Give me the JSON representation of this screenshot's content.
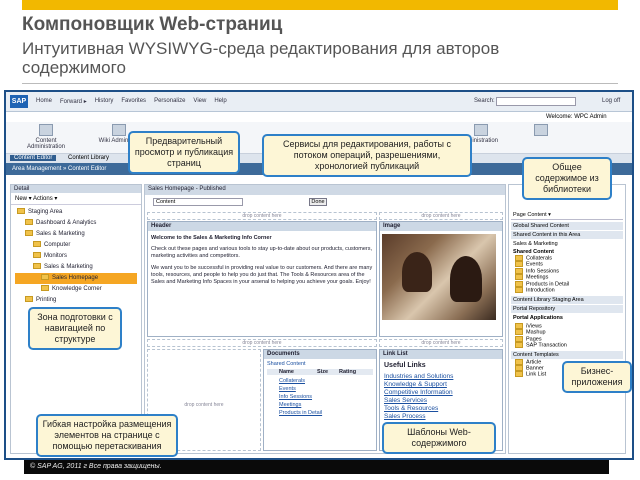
{
  "title": "Компоновщик Web-страниц",
  "subtitle": "Интуитивная WYSIWYG-среда редактирования для авторов содержимого",
  "sap": {
    "logo": "SAP",
    "menu": [
      "Home",
      "Forward ▸",
      "History",
      "Favorites",
      "Personalize",
      "View",
      "Help"
    ],
    "search_label": "Search:",
    "welcome": "Welcome: WPC Admin",
    "logoff": "Log off"
  },
  "toolbar": [
    "Content Administration",
    "Wiki Administ...",
    "",
    "",
    "",
    "",
    "",
    "",
    "",
    "",
    "dministration"
  ],
  "tabs": [
    "Content Editor",
    "Content Library"
  ],
  "crumb": "Area Management  »  Content Editor",
  "tree": {
    "head": "Detail",
    "actions": "New ▾   Actions ▾",
    "items": [
      "Staging Area",
      "Dashboard & Analytics",
      "Sales & Marketing",
      "Computer",
      "Monitors",
      "Sales & Marketing",
      "Sales Homepage",
      "Knowledge Corner",
      "Printing"
    ]
  },
  "page_head": "Sales Homepage - Published",
  "page_select": "Content",
  "page_done": "Done",
  "drop": "drop content here",
  "header_panel": {
    "title": "Header",
    "heading": "Welcome to the Sales & Marketing Info Corner",
    "p1": "Check out these pages and various tools to stay up-to-date about our products, customers, marketing activities and competitors.",
    "p2": "We want you to be successful in providing real value to our customers. And there are many tools, resources, and people to help you do just that. The Tools & Resources area of the Sales and Marketing Info Spaces in your arsenal to helping you achieve your goals. Enjoy!"
  },
  "image_panel": {
    "title": "Image"
  },
  "documents": {
    "title": "Documents",
    "folder": "Shared Content",
    "cols": [
      "Name",
      "Size",
      "Rating"
    ],
    "rows": [
      "Collaterals",
      "Events",
      "Info Sessions",
      "Meetings",
      "Products in Detail"
    ]
  },
  "linklist": {
    "title": "Link List",
    "heading": "Useful Links",
    "links": [
      "Industries and Solutions",
      "Knowledge & Support",
      "Competitive Information",
      "Sales Services",
      "Tools & Resources",
      "Sales Process"
    ]
  },
  "right": {
    "page_content": "Page Content ▾",
    "sections": [
      "Global Shared Content",
      "Shared Content in this Area",
      "Content Library Staging Area",
      "Portal Repository",
      "Content Templates"
    ],
    "sales_link": "Sales & Marketing",
    "shared_label": "Shared Content",
    "shared_items": [
      "Collaterals",
      "Events",
      "Info Sessions",
      "Meetings",
      "Products in Detail",
      "Introduction"
    ],
    "portal_label": "Portal Applications",
    "portal_items": [
      "iViews",
      "Mashup",
      "Pages",
      "SAP Transaction"
    ],
    "template_items": [
      "Article",
      "Banner",
      "Link List"
    ]
  },
  "callouts": {
    "preview": "Предварительный просмотр и публикация страниц",
    "services": "Сервисы для редактирования, работы с потоком операций, разрешениями, хронологией публикаций",
    "shared": "Общее содержимое из библиотеки",
    "staging": "Зона подготовки с навигацией по структуре",
    "business": "Бизнес-приложения",
    "flex": "Гибкая настройка размещения элементов на странице с помощью перетаскивания",
    "templates": "Шаблоны Web-содержимого"
  },
  "footer": "©  SAP AG, 2011 г Все права защищены.",
  "colors": {
    "accent_bar": "#f2b800",
    "frame": "#1d4f87",
    "callout_border": "#2e80c8",
    "callout_bg": "#fdf6d6",
    "highlight": "#f5a623"
  }
}
